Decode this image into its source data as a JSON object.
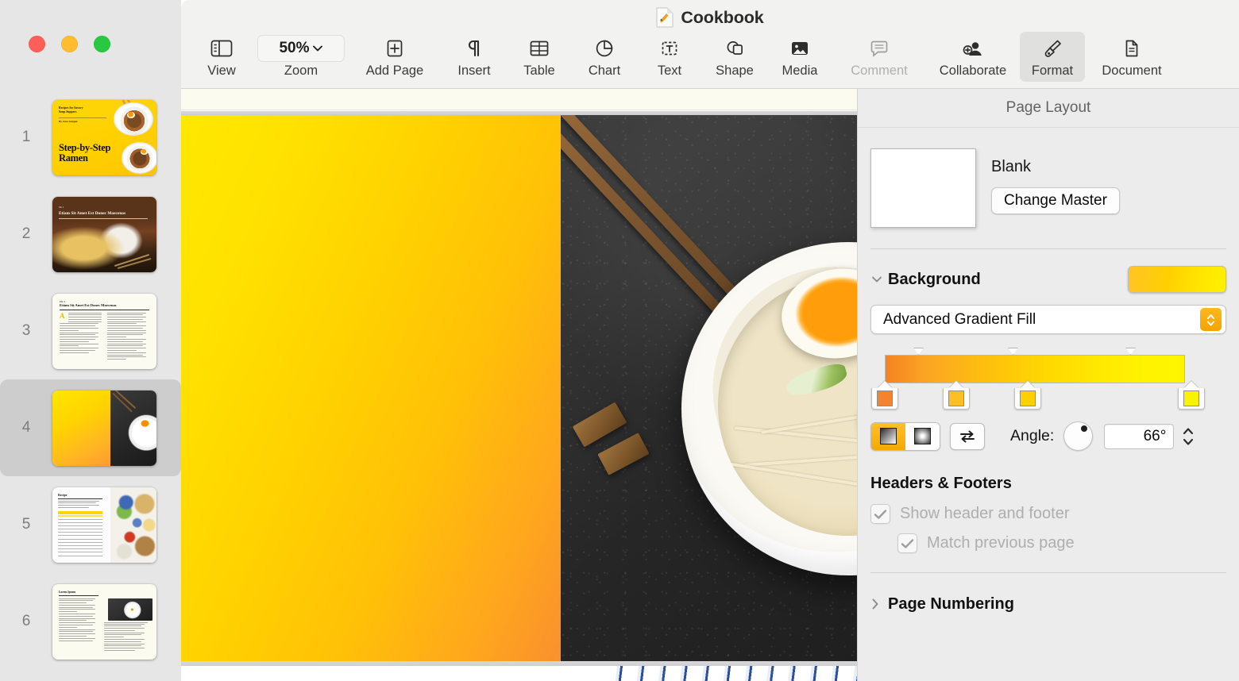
{
  "window": {
    "title": "Cookbook",
    "doc_icon": "pages-document-icon",
    "traffic_lights": [
      {
        "name": "close-button",
        "color": "#ff5f57"
      },
      {
        "name": "minimize-button",
        "color": "#febc2e"
      },
      {
        "name": "maximize-button",
        "color": "#28c840"
      }
    ]
  },
  "toolbar": {
    "items": [
      {
        "label": "View",
        "icon": "sidebar-icon",
        "disabled": false,
        "active": false
      },
      {
        "label": "Zoom",
        "icon": "zoom-chevron",
        "disabled": false,
        "active": false,
        "value": "50%"
      },
      {
        "label": "Add Page",
        "icon": "plus-square-icon",
        "disabled": false,
        "active": false
      },
      {
        "label": "Insert",
        "icon": "pilcrow-icon",
        "disabled": false,
        "active": false
      },
      {
        "label": "Table",
        "icon": "table-icon",
        "disabled": false,
        "active": false
      },
      {
        "label": "Chart",
        "icon": "pie-chart-icon",
        "disabled": false,
        "active": false
      },
      {
        "label": "Text",
        "icon": "text-box-icon",
        "disabled": false,
        "active": false
      },
      {
        "label": "Shape",
        "icon": "shapes-icon",
        "disabled": false,
        "active": false
      },
      {
        "label": "Media",
        "icon": "image-icon",
        "disabled": false,
        "active": false
      },
      {
        "label": "Comment",
        "icon": "comment-icon",
        "disabled": true,
        "active": false
      },
      {
        "label": "Collaborate",
        "icon": "add-person-icon",
        "disabled": false,
        "active": false
      },
      {
        "label": "Format",
        "icon": "paintbrush-icon",
        "disabled": false,
        "active": true
      },
      {
        "label": "Document",
        "icon": "document-icon",
        "disabled": false,
        "active": false
      }
    ]
  },
  "sidebar": {
    "pages": [
      {
        "number": "1",
        "name": "page-thumbnail-1",
        "selected": false,
        "kicker": "Recipes for Savory\nSoup Suppers",
        "byline": "By Uma Semper",
        "title": "Step-by-Step\nRamen"
      },
      {
        "number": "2",
        "name": "page-thumbnail-2",
        "selected": false,
        "eyebrow": "Ch. 1",
        "title": "Etiam Sit Amet Est Donec Maecenas"
      },
      {
        "number": "3",
        "name": "page-thumbnail-3",
        "selected": false,
        "eyebrow": "Ch. 1",
        "title": "Etiam Sit Amet Est Donec Maecenas",
        "dropcap": "A"
      },
      {
        "number": "4",
        "name": "page-thumbnail-4",
        "selected": true
      },
      {
        "number": "5",
        "name": "page-thumbnail-5",
        "selected": false,
        "title": "Recipe"
      },
      {
        "number": "6",
        "name": "page-thumbnail-6",
        "selected": false,
        "title": "Lorem Ipsum"
      }
    ]
  },
  "inspector": {
    "title": "Page Layout",
    "master": {
      "name": "Blank",
      "change_button": "Change Master"
    },
    "background": {
      "label": "Background",
      "expanded": true,
      "swatch_colors": [
        "#ffc327",
        "#fff000"
      ],
      "fill_type": "Advanced Gradient Fill",
      "gradient_stops": [
        {
          "position": "0%",
          "color": "#f58220"
        },
        {
          "position": "32%",
          "color": "#fdbe26"
        },
        {
          "position": "54%",
          "color": "#fdd000"
        },
        {
          "position": "100%",
          "color": "#fbf200"
        }
      ],
      "gradient_top_markers": [
        "9%",
        "33%",
        "72%"
      ],
      "type_linear_selected": true,
      "type_radial_selected": false,
      "flip_button": "flip-gradient-icon",
      "angle_label": "Angle:",
      "angle_value": "66°"
    },
    "headers_footers": {
      "title": "Headers & Footers",
      "show_header_footer": {
        "label": "Show header and footer",
        "checked": true,
        "enabled": false
      },
      "match_previous_page": {
        "label": "Match previous page",
        "checked": true,
        "enabled": false
      }
    },
    "page_numbering": {
      "label": "Page Numbering",
      "expanded": false
    }
  },
  "canvas": {
    "current_page": "4",
    "page_name": "page-4-gradient-ramen"
  }
}
